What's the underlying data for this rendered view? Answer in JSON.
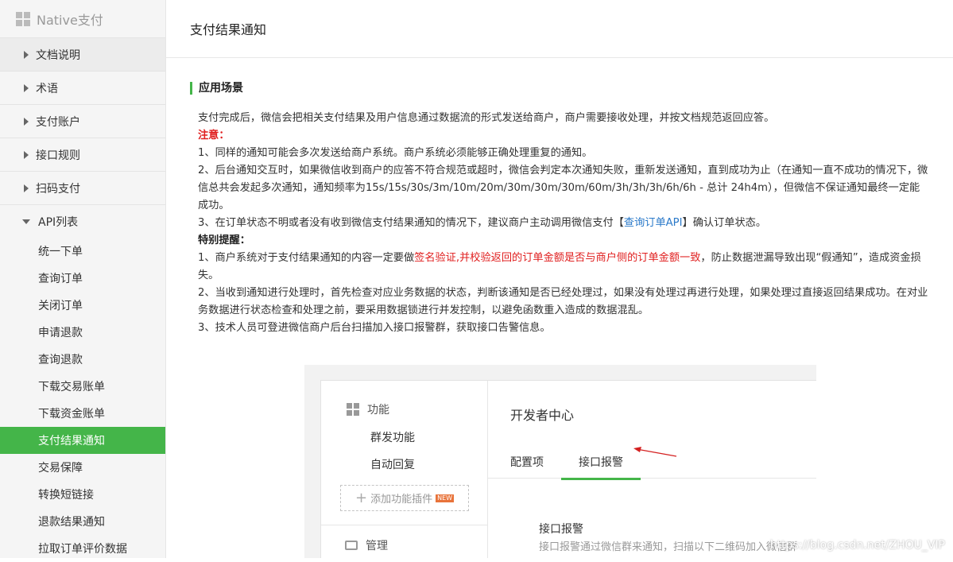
{
  "sidebar": {
    "title": "Native支付",
    "sections": [
      {
        "label": "文档说明"
      },
      {
        "label": "术语"
      },
      {
        "label": "支付账户"
      },
      {
        "label": "接口规则"
      },
      {
        "label": "扫码支付"
      }
    ],
    "api_label": "API列表",
    "api_items": [
      {
        "label": "统一下单"
      },
      {
        "label": "查询订单"
      },
      {
        "label": "关闭订单"
      },
      {
        "label": "申请退款"
      },
      {
        "label": "查询退款"
      },
      {
        "label": "下载交易账单"
      },
      {
        "label": "下载资金账单"
      },
      {
        "label": "支付结果通知",
        "active": true
      },
      {
        "label": "交易保障"
      },
      {
        "label": "转换短链接"
      },
      {
        "label": "退款结果通知"
      },
      {
        "label": "拉取订单评价数据"
      }
    ]
  },
  "main": {
    "page_title": "支付结果通知",
    "section_title": "应用场景",
    "intro": "支付完成后，微信会把相关支付结果及用户信息通过数据流的形式发送给商户，商户需要接收处理，并按文档规范返回应答。",
    "note_label": "注意：",
    "note1": "1、同样的通知可能会多次发送给商户系统。商户系统必须能够正确处理重复的通知。",
    "note2": "2、后台通知交互时，如果微信收到商户的应答不符合规范或超时，微信会判定本次通知失败，重新发送通知，直到成功为止（在通知一直不成功的情况下，微信总共会发起多次通知，通知频率为15s/15s/30s/3m/10m/20m/30m/30m/30m/60m/3h/3h/3h/6h/6h - 总计 24h4m），但微信不保证通知最终一定能成功。",
    "note3_pre": "3、在订单状态不明或者没有收到微信支付结果通知的情况下，建议商户主动调用微信支付【",
    "note3_link": "查询订单API",
    "note3_post": "】确认订单状态。",
    "remind_label": "特别提醒：",
    "remind1_pre": "1、商户系统对于支付结果通知的内容一定要做",
    "remind1_red": "签名验证,并校验返回的订单金额是否与商户侧的订单金额一致",
    "remind1_post": "，防止数据泄漏导致出现“假通知”，造成资金损失。",
    "remind2": "2、当收到通知进行处理时，首先检查对应业务数据的状态，判断该通知是否已经处理过，如果没有处理过再进行处理，如果处理过直接返回结果成功。在对业务数据进行状态检查和处理之前，要采用数据锁进行并发控制，以避免函数重入造成的数据混乱。",
    "remind3": "3、技术人员可登进微信商户后台扫描加入接口报警群，获取接口告警信息。"
  },
  "screenshot": {
    "func_label": "功能",
    "func_items": [
      "群发功能",
      "自动回复"
    ],
    "add_plugin": "添加功能插件",
    "new_badge": "NEW",
    "manage_label": "管理",
    "dev_center": "开发者中心",
    "tabs": [
      "配置项",
      "接口报警"
    ],
    "alarm_title": "接口报警",
    "alarm_desc": "接口报警通过微信群来通知，扫描以下二维码加入微信群"
  },
  "watermark": "https://blog.csdn.net/ZHOU_VIP",
  "colors": {
    "accent": "#44b549",
    "warning": "#e02020",
    "link": "#2a79c9"
  }
}
